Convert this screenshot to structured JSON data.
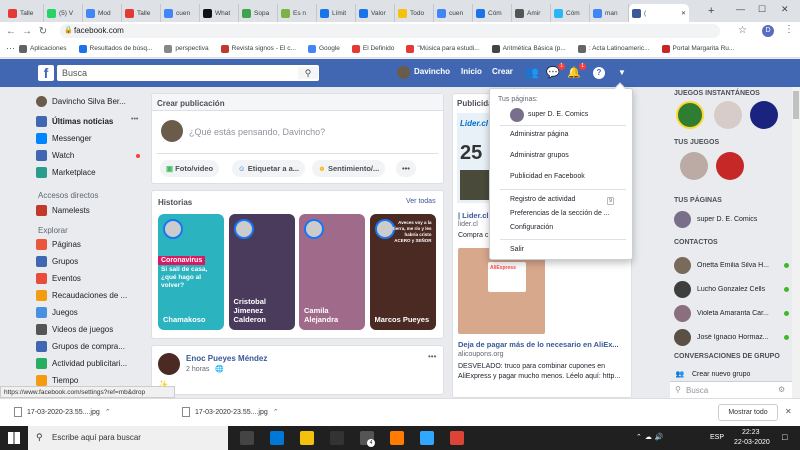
{
  "browser": {
    "tabs": [
      {
        "label": "Talle",
        "color": "#e53935"
      },
      {
        "label": "(5) V",
        "color": "#25d366"
      },
      {
        "label": "Mod",
        "color": "#4285f4"
      },
      {
        "label": "Talle",
        "color": "#e53935"
      },
      {
        "label": "cuen",
        "color": "#4285f4"
      },
      {
        "label": "What",
        "color": "#111111"
      },
      {
        "label": "Sopa",
        "color": "#3fa34d"
      },
      {
        "label": "Es n",
        "color": "#7cb342"
      },
      {
        "label": "Límit",
        "color": "#1a73e8"
      },
      {
        "label": "Valor",
        "color": "#1a73e8"
      },
      {
        "label": "Todo",
        "color": "#f4c20d"
      },
      {
        "label": "cuen",
        "color": "#4285f4"
      },
      {
        "label": "Cóm",
        "color": "#1a73e8"
      },
      {
        "label": "Amir",
        "color": "#555555"
      },
      {
        "label": "Cóm",
        "color": "#29b6f6"
      },
      {
        "label": "man",
        "color": "#4285f4"
      },
      {
        "label": "(",
        "color": "#3b5998"
      }
    ],
    "new_tab": "+",
    "window_controls": [
      "—",
      "☐",
      "✕"
    ],
    "nav": {
      "back": "←",
      "forward": "→",
      "reload": "↻"
    },
    "url": "facebook.com",
    "star": "☆",
    "profile_initial": "D",
    "menu": "⋮",
    "bookmarks": [
      {
        "label": "Aplicaciones",
        "color": "#5f6368"
      },
      {
        "label": "Resultados de búsq...",
        "color": "#1a73e8"
      },
      {
        "label": "perspectiva",
        "color": "#888888"
      },
      {
        "label": "Revista signos - El c...",
        "color": "#c0392b"
      },
      {
        "label": "Google",
        "color": "#4285f4"
      },
      {
        "label": "El Definido",
        "color": "#e53935"
      },
      {
        "label": "\"Música para estudi...",
        "color": "#e53935"
      },
      {
        "label": "Aritmética Básica (p...",
        "color": "#444444"
      },
      {
        "label": ": Acta Latinoameric...",
        "color": "#666666"
      },
      {
        "label": "Portal Margarita Ru...",
        "color": "#c62828"
      }
    ]
  },
  "fb": {
    "logo": "f",
    "search_placeholder": "Busca",
    "search_icon": "⚲",
    "user_name": "Davincho",
    "nav": [
      "Inicio",
      "Crear"
    ],
    "badges": {
      "messages": "1",
      "notifications": "1"
    },
    "help": "?",
    "arrow": "▼"
  },
  "left_nav": {
    "profile": "Davincho Silva Ber...",
    "items": [
      {
        "label": "Últimas noticias",
        "color": "#4267b2"
      },
      {
        "label": "Messenger",
        "color": "#0084ff"
      },
      {
        "label": "Watch",
        "color": "#4267b2"
      },
      {
        "label": "Marketplace",
        "color": "#2a9d8f"
      }
    ],
    "more": "•••",
    "shortcuts_title": "Accesos directos",
    "shortcuts": [
      {
        "label": "Namelests",
        "color": "#c0392b"
      }
    ],
    "explore_title": "Explorar",
    "explore": [
      {
        "label": "Páginas",
        "color": "#e9573f"
      },
      {
        "label": "Grupos",
        "color": "#4267b2"
      },
      {
        "label": "Eventos",
        "color": "#e74c3c"
      },
      {
        "label": "Recaudaciones de ...",
        "color": "#f39c12"
      },
      {
        "label": "Juegos",
        "color": "#4a90e2"
      },
      {
        "label": "Videos de juegos",
        "color": "#555555"
      },
      {
        "label": "Grupos de compra...",
        "color": "#4267b2"
      },
      {
        "label": "Actividad publicitari...",
        "color": "#27ae60"
      },
      {
        "label": "Tiempo",
        "color": "#f39c12"
      }
    ]
  },
  "composer": {
    "title": "Crear publicación",
    "placeholder": "¿Qué estás pensando, Davincho?",
    "actions": [
      "Foto/video",
      "Etiquetar a a...",
      "Sentimiento/...",
      "•••"
    ]
  },
  "stories": {
    "title": "Historias",
    "see_all": "Ver todas",
    "items": [
      {
        "name": "Chamakoso",
        "caption_top": "Coronavirus",
        "caption": "Si sali de casa, ¿qué hago al volver?",
        "color": "#2bb3c0"
      },
      {
        "name": "Cristobal Jimenez Calderon",
        "color": "#4a3b5c"
      },
      {
        "name": "Camila Alejandra",
        "color": "#a06b8a"
      },
      {
        "name": "Marcos Pueyes",
        "caption": "Aveces voy a la tierra, me río y les habría cristo ACERO y SEÑOR",
        "color": "#4a2a22"
      }
    ]
  },
  "post": {
    "author": "Enoc Pueyes Méndez",
    "time": "2 horas",
    "more": "•••"
  },
  "dropdown": {
    "section_title": "Tus páginas:",
    "page_name": "super D. E. Comics",
    "items_a": [
      "Administrar página",
      "Administrar grupos",
      "Publicidad en Facebook"
    ],
    "items_b": [
      "Registro de actividad",
      "Preferencias de la sección de ...",
      "Configuración"
    ],
    "activity_badge": "9",
    "logout": "Salir"
  },
  "ads": {
    "title": "Publicidad",
    "ad1_brand": "Lider.cl",
    "ad1_num": "25",
    "ad1_title": "| Lider.cl",
    "ad1_link": "lider.cl",
    "ad1_text": "Compra c",
    "ad2_brand": "AliExpress",
    "ad2_title": "Deja de pagar más de lo necesario en AliEx...",
    "ad2_link": "alicoupons.org",
    "ad2_text": "DESVELADO: truco para combinar cupones en AliExpress y pagar mucho menos. Léelo aquí: http..."
  },
  "right": {
    "games_title": "JUEGOS INSTANTÁNEOS",
    "your_games_title": "TUS JUEGOS",
    "pages_title": "TUS PÁGINAS",
    "page_name": "super D. E. Comics",
    "contacts_title": "CONTACTOS",
    "contacts": [
      {
        "name": "Orietta Emilia Silva H...",
        "color": "#7a6a5a"
      },
      {
        "name": "Lucho Gonzalez Cells",
        "color": "#3e3e3e"
      },
      {
        "name": "Violeta Amaranta Car...",
        "color": "#8a6f7f"
      },
      {
        "name": "José Ignacio Hormaz...",
        "color": "#5a5046"
      }
    ],
    "group_title": "CONVERSACIONES DE GRUPO",
    "new_group": "Crear nuevo grupo",
    "search_placeholder": "Busca"
  },
  "status_url": "https://www.facebook.com/settings?ref=mb&drop",
  "downloads": {
    "files": [
      "17-03-2020-23.55....jpg",
      "17-03-2020-23.55....jpg"
    ],
    "show_all": "Mostrar todo",
    "close": "✕"
  },
  "taskbar": {
    "search_placeholder": "Escribe aquí para buscar",
    "lang": "ESP",
    "time": "22:23",
    "date": "22-03-2020",
    "edge_badge": "4",
    "apps": [
      {
        "name": "task-view",
        "color": "#444444"
      },
      {
        "name": "edge",
        "color": "#0078d7"
      },
      {
        "name": "file-explorer",
        "color": "#f4c20d"
      },
      {
        "name": "store",
        "color": "#333333"
      },
      {
        "name": "mail",
        "color": "#555555"
      },
      {
        "name": "illustrator",
        "color": "#ff7c00"
      },
      {
        "name": "photoshop",
        "color": "#31a8ff"
      },
      {
        "name": "chrome",
        "color": "#db4437"
      }
    ]
  }
}
